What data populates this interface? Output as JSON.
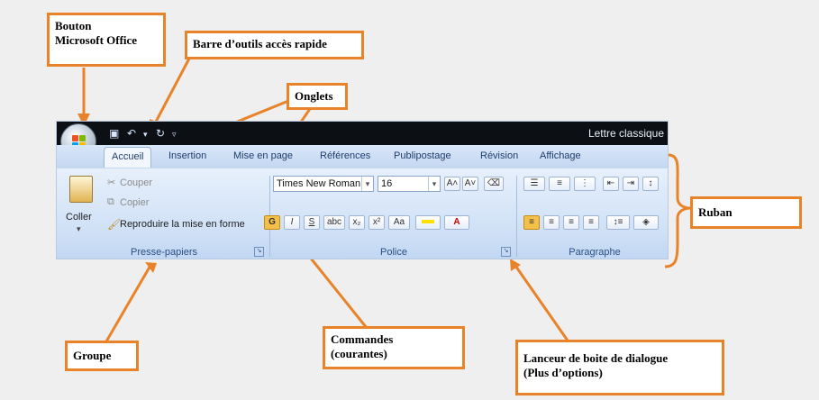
{
  "callouts": {
    "office_button": "Bouton\nMicrosoft Office",
    "quick_access": "Barre d’outils accès rapide",
    "tabs": "Onglets",
    "ribbon": "Ruban",
    "group": "Groupe",
    "commands": "Commandes\n(courantes)",
    "dialog_launcher": "Lanceur de boite de dialogue\n(Plus d’options)"
  },
  "window": {
    "title": "Lettre classique"
  },
  "tabs": [
    "Accueil",
    "Insertion",
    "Mise en page",
    "Références",
    "Publipostage",
    "Révision",
    "Affichage"
  ],
  "ribbon": {
    "clipboard": {
      "paste": "Coller",
      "cut": "Couper",
      "copy": "Copier",
      "format_painter": "Reproduire la mise en forme",
      "label": "Presse-papiers"
    },
    "font": {
      "font_name": "Times New Roman",
      "font_size": "16",
      "label": "Police"
    },
    "paragraph": {
      "label": "Paragraphe"
    }
  },
  "colors": {
    "callout_border": "#e8832a",
    "titlebar": "#0c0f14",
    "ribbon_bg": "#cfe0f6",
    "active_tab": "#f2f7ff"
  }
}
